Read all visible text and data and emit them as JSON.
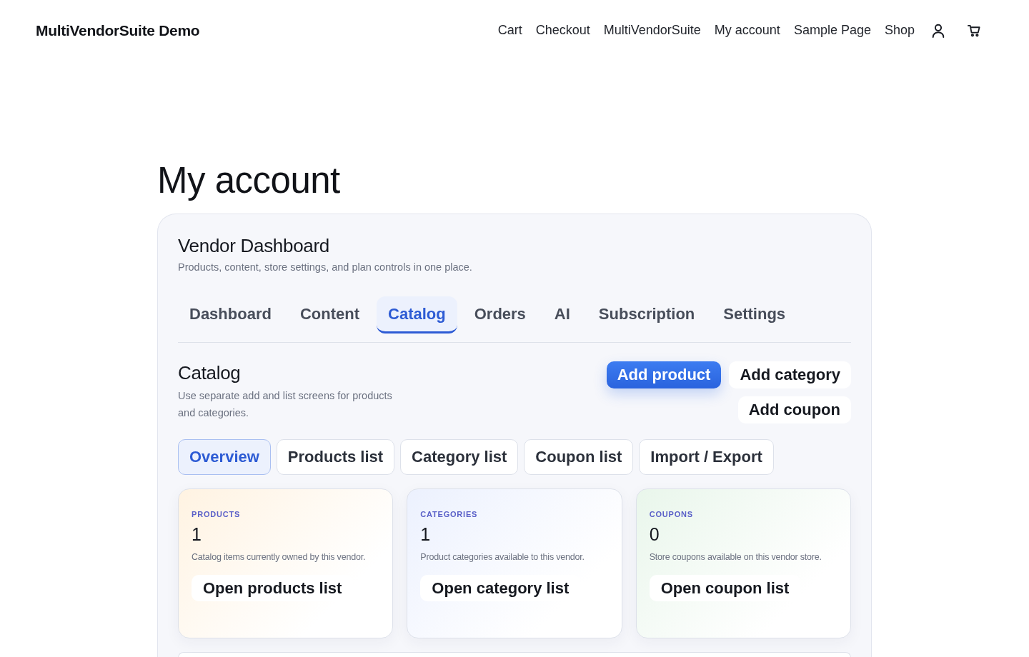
{
  "site": {
    "title": "MultiVendorSuite Demo"
  },
  "nav": {
    "items": [
      "Cart",
      "Checkout",
      "MultiVendorSuite",
      "My account",
      "Sample Page",
      "Shop"
    ]
  },
  "page_title": "My account",
  "dashboard": {
    "title": "Vendor Dashboard",
    "subtitle": "Products, content, store settings, and plan controls in one place.",
    "tabs": [
      {
        "label": "Dashboard",
        "selected": false
      },
      {
        "label": "Content",
        "selected": false
      },
      {
        "label": "Catalog",
        "selected": true
      },
      {
        "label": "Orders",
        "selected": false
      },
      {
        "label": "AI",
        "selected": false
      },
      {
        "label": "Subscription",
        "selected": false
      },
      {
        "label": "Settings",
        "selected": false
      }
    ],
    "section": {
      "title": "Catalog",
      "description": "Use separate add and list screens for products and categories.",
      "actions": [
        {
          "label": "Add product",
          "kind": "primary"
        },
        {
          "label": "Add category",
          "kind": "secondary"
        },
        {
          "label": "Add coupon",
          "kind": "secondary"
        }
      ],
      "subtabs": [
        {
          "label": "Overview",
          "selected": true
        },
        {
          "label": "Products list",
          "selected": false
        },
        {
          "label": "Category list",
          "selected": false
        },
        {
          "label": "Coupon list",
          "selected": false
        },
        {
          "label": "Import / Export",
          "selected": false
        }
      ],
      "cards": [
        {
          "label": "PRODUCTS",
          "value": "1",
          "description": "Catalog items currently owned by this vendor.",
          "button": "Open products list",
          "color": "#fff3e2"
        },
        {
          "label": "CATEGORIES",
          "value": "1",
          "description": "Product categories available to this vendor.",
          "button": "Open category list",
          "color": "#ecf1fe"
        },
        {
          "label": "COUPONS",
          "value": "0",
          "description": "Store coupons available on this vendor store.",
          "button": "Open coupon list",
          "color": "#e9f6eb"
        }
      ]
    }
  }
}
